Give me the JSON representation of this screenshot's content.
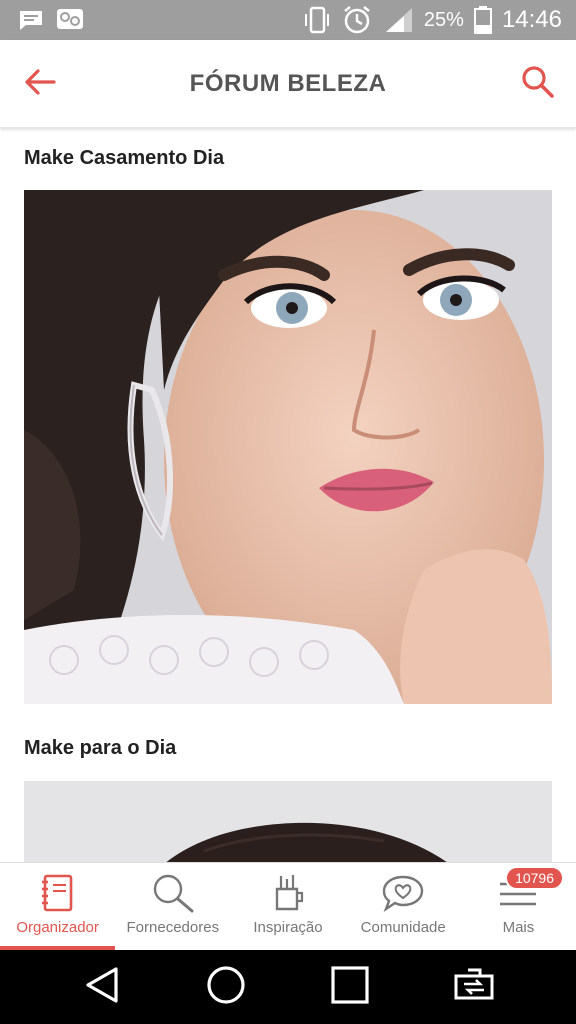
{
  "status_bar": {
    "battery_percent": "25%",
    "time": "14:46",
    "icons": [
      "message-icon",
      "chat-app-icon",
      "vibrate-icon",
      "alarm-icon",
      "signal-icon",
      "battery-icon"
    ]
  },
  "header": {
    "title": "FÓRUM BELEZA",
    "icons": [
      "back-arrow-icon",
      "search-icon"
    ],
    "accent_color": "#e2554f"
  },
  "posts": [
    {
      "title": "Make Casamento Dia",
      "image": "bridal-makeup-photo"
    },
    {
      "title": "Make para o Dia",
      "image": "bridal-hair-photo"
    }
  ],
  "bottom_nav": {
    "items": [
      {
        "label": "Organizador",
        "icon": "planner-icon",
        "active": true
      },
      {
        "label": "Fornecedores",
        "icon": "search-icon",
        "active": false
      },
      {
        "label": "Inspiração",
        "icon": "inspiration-icon",
        "active": false
      },
      {
        "label": "Comunidade",
        "icon": "community-heart-icon",
        "active": false
      },
      {
        "label": "Mais",
        "icon": "menu-icon",
        "active": false,
        "badge": "10796"
      }
    ]
  },
  "system_nav": {
    "icons": [
      "back-triangle-icon",
      "home-circle-icon",
      "recents-square-icon",
      "screen-mirror-icon"
    ]
  }
}
